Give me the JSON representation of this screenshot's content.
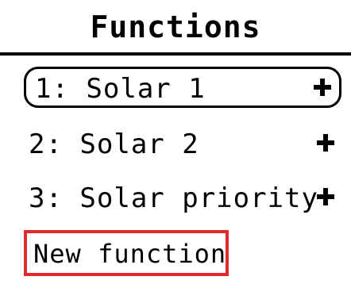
{
  "header": {
    "title": "Functions"
  },
  "list": {
    "items": [
      {
        "label": "1: Solar 1",
        "icon": "plus-icon",
        "selected": true
      },
      {
        "label": "2: Solar 2",
        "icon": "plus-icon",
        "selected": false
      },
      {
        "label": "3: Solar priority",
        "icon": "plus-icon",
        "selected": false
      }
    ]
  },
  "new_function": {
    "label": "New function",
    "highlight_color": "#e32b2b"
  }
}
